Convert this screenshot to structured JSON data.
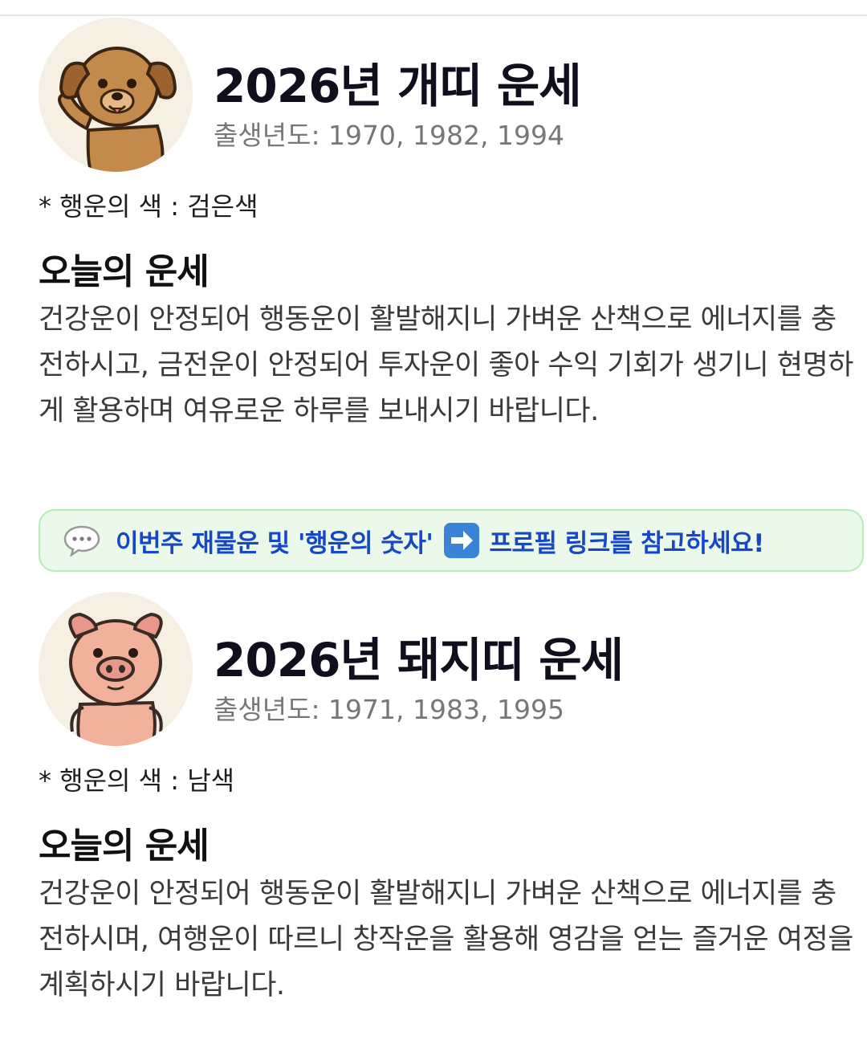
{
  "sections": [
    {
      "animal_icon": "dog-icon",
      "title": "2026년 개띠 운세",
      "birth_years": "출생년도: 1970, 1982, 1994",
      "lucky_color": "* 행운의 색 : 검은색",
      "today_heading": "오늘의 운세",
      "fortune": "건강운이 안정되어 행동운이 활발해지니 가벼운 산책으로 에너지를 충전하시고, 금전운이 안정되어 투자운이 좋아 수익 기회가 생기니 현명하게 활용하며 여유로운 하루를 보내시기 바랍니다."
    },
    {
      "animal_icon": "pig-icon",
      "title": "2026년 돼지띠 운세",
      "birth_years": "출생년도: 1971, 1983, 1995",
      "lucky_color": "* 행운의 색 : 남색",
      "today_heading": "오늘의 운세",
      "fortune": "건강운이 안정되어 행동운이 활발해지니 가벼운 산책으로 에너지를 충전하시며, 여행운이 따르니 창작운을 활용해 영감을 얻는 즐거운 여정을 계획하시기 바랍니다."
    }
  ],
  "banner": {
    "icon": "speech-bubble-icon",
    "text_before": "이번주 재물운 및 '행운의 숫자'",
    "arrow_icon": "right-arrow-icon",
    "text_after": "프로필 링크를 참고하세요!"
  },
  "colors": {
    "banner_bg": "#eaf9ea",
    "banner_border": "#b7ebb7",
    "banner_text": "#1747c7",
    "arrow_bg": "#3b83d6"
  }
}
